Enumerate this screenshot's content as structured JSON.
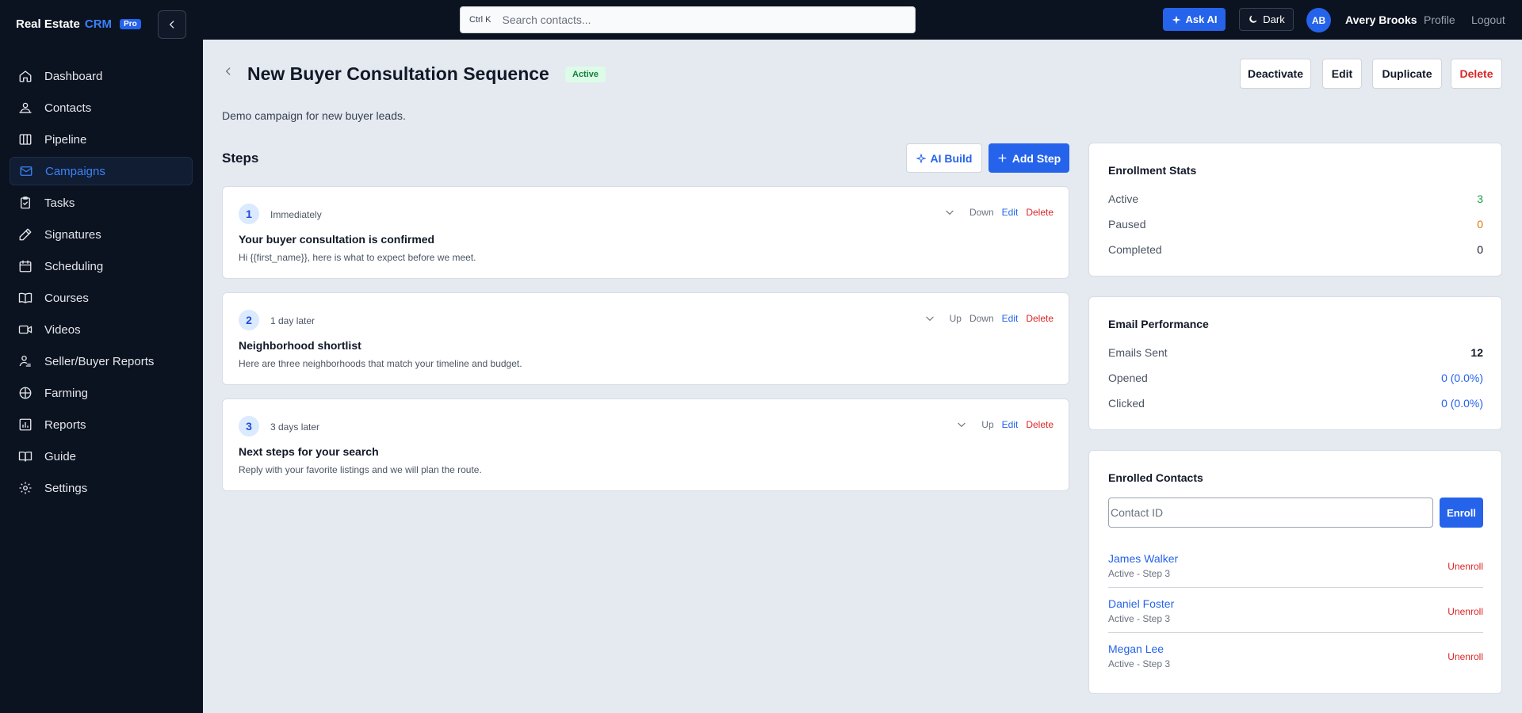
{
  "brand": {
    "name": "Real Estate",
    "crm": "CRM",
    "badge": "Pro"
  },
  "sidebar": {
    "items": [
      {
        "label": "Dashboard",
        "icon": "home-icon"
      },
      {
        "label": "Contacts",
        "icon": "contacts-icon"
      },
      {
        "label": "Pipeline",
        "icon": "pipeline-icon"
      },
      {
        "label": "Campaigns",
        "icon": "mail-icon",
        "active": true
      },
      {
        "label": "Tasks",
        "icon": "clipboard-icon"
      },
      {
        "label": "Signatures",
        "icon": "pen-icon"
      },
      {
        "label": "Scheduling",
        "icon": "calendar-icon"
      },
      {
        "label": "Courses",
        "icon": "book-icon"
      },
      {
        "label": "Videos",
        "icon": "video-icon"
      },
      {
        "label": "Seller/Buyer Reports",
        "icon": "user-report-icon"
      },
      {
        "label": "Farming",
        "icon": "globe-icon"
      },
      {
        "label": "Reports",
        "icon": "bar-chart-icon"
      },
      {
        "label": "Guide",
        "icon": "open-book-icon"
      },
      {
        "label": "Settings",
        "icon": "gear-icon"
      }
    ]
  },
  "topbar": {
    "search_shortcut": "Ctrl K",
    "search_placeholder": "Search contacts...",
    "ask_ai_label": "Ask AI",
    "dark_label": "Dark",
    "avatar_initials": "AB",
    "user_name": "Avery Brooks",
    "profile_label": "Profile",
    "logout_label": "Logout"
  },
  "campaign": {
    "title": "New Buyer Consultation Sequence",
    "status": "Active",
    "description": "Demo campaign for new buyer leads.",
    "buttons": {
      "deactivate": "Deactivate",
      "edit": "Edit",
      "duplicate": "Duplicate",
      "delete": "Delete"
    }
  },
  "steps_section": {
    "title": "Steps",
    "ai_build_label": "AI Build",
    "add_step_label": "Add Step",
    "steps": [
      {
        "number": "1",
        "delay": "Immediately",
        "subject": "Your buyer consultation is confirmed",
        "preview": "Hi {{first_name}}, here is what to expect before we meet.",
        "up": null,
        "down": "Down",
        "edit": "Edit",
        "delete": "Delete"
      },
      {
        "number": "2",
        "delay": "1 day later",
        "subject": "Neighborhood shortlist",
        "preview": "Here are three neighborhoods that match your timeline and budget.",
        "up": "Up",
        "down": "Down",
        "edit": "Edit",
        "delete": "Delete"
      },
      {
        "number": "3",
        "delay": "3 days later",
        "subject": "Next steps for your search",
        "preview": "Reply with your favorite listings and we will plan the route.",
        "up": "Up",
        "down": null,
        "edit": "Edit",
        "delete": "Delete"
      }
    ]
  },
  "enrollment_stats": {
    "title": "Enrollment Stats",
    "rows": [
      {
        "label": "Active",
        "value": "3"
      },
      {
        "label": "Paused",
        "value": "0"
      },
      {
        "label": "Completed",
        "value": "0"
      }
    ]
  },
  "email_performance": {
    "title": "Email Performance",
    "rows": [
      {
        "label": "Emails Sent",
        "value": "12"
      },
      {
        "label": "Opened",
        "value": "0 (0.0%)"
      },
      {
        "label": "Clicked",
        "value": "0 (0.0%)"
      }
    ]
  },
  "enrolled_contacts": {
    "title": "Enrolled Contacts",
    "input_placeholder": "Contact ID",
    "enroll_label": "Enroll",
    "contacts": [
      {
        "name": "James Walker",
        "status": "Active - Step 3",
        "action": "Unenroll"
      },
      {
        "name": "Daniel Foster",
        "status": "Active - Step 3",
        "action": "Unenroll"
      },
      {
        "name": "Megan Lee",
        "status": "Active - Step 3",
        "action": "Unenroll"
      }
    ]
  },
  "colors": {
    "accent": "#2563eb",
    "sidebar_bg": "#0b1220",
    "page_bg": "#e5e9f0",
    "danger": "#dc2626",
    "success": "#16a34a",
    "warning": "#d97706"
  }
}
